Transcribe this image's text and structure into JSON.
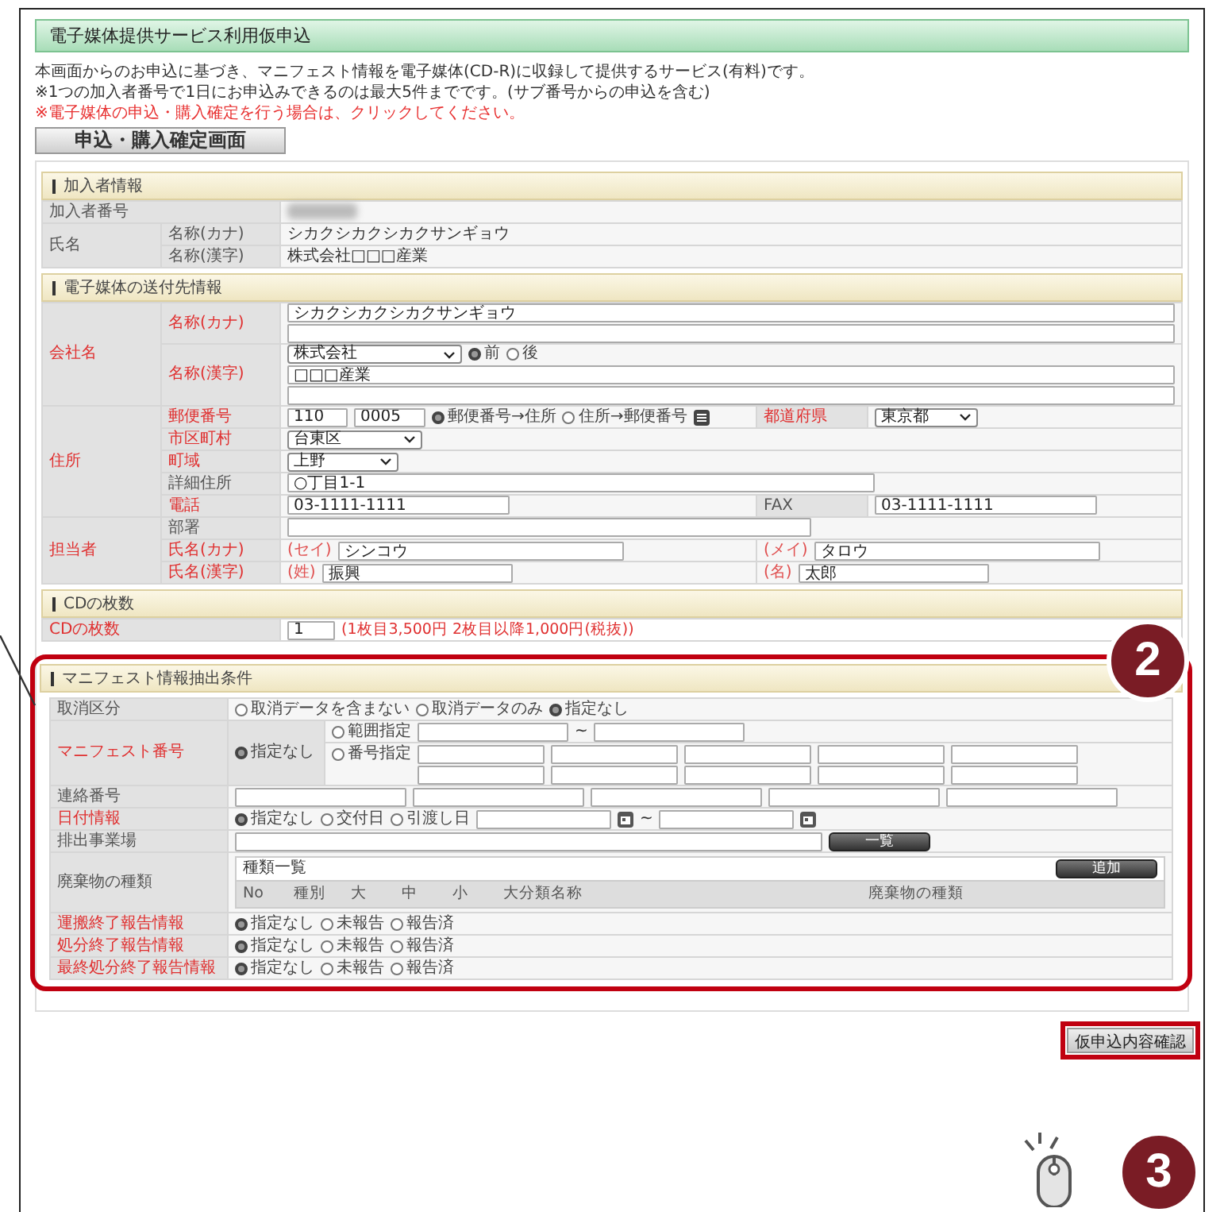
{
  "title": "電子媒体提供サービス利用仮申込",
  "intro": [
    "本画面からのお申込に基づき、マニフェスト情報を電子媒体(CD-R)に収録して提供するサービス(有料)です。",
    "※1つの加入者番号で1日にお申込みできるのは最大5件までです。(サブ番号からの申込を含む)"
  ],
  "notice": "※電子媒体の申込・購入確定を行う場合は、クリックしてください。",
  "purchase_button": "申込・購入確定画面",
  "subscriber": {
    "heading": "加入者情報",
    "number_label": "加入者番号",
    "name_label": "氏名",
    "names": [
      {
        "label": "名称(カナ)",
        "value": "シカクシカクシカクサンギョウ"
      },
      {
        "label": "名称(漢字)",
        "value": "株式会社□□□産業"
      }
    ]
  },
  "delivery": {
    "heading": "電子媒体の送付先情報",
    "company": {
      "label": {
        "text": "会社名",
        "required": true
      },
      "kana_label": {
        "text": "名称(カナ)",
        "required": true
      },
      "kana_value": "シカクシカクシカクサンギョウ",
      "kanji_label": {
        "text": "名称(漢字)",
        "required": true
      },
      "corp_type": "株式会社",
      "position_options": [
        {
          "label": "前",
          "selected": true
        },
        {
          "label": "後",
          "selected": false
        }
      ],
      "kanji_value": "□□□産業"
    },
    "address": {
      "label": {
        "text": "住所",
        "required": true
      },
      "postal_label": {
        "text": "郵便番号",
        "required": true
      },
      "postal": [
        "110",
        "0005"
      ],
      "lookup_options": [
        {
          "label": "郵便番号→住所",
          "selected": true
        },
        {
          "label": "住所→郵便番号",
          "selected": false
        }
      ],
      "prefecture_label": {
        "text": "都道府県",
        "required": true
      },
      "prefecture": "東京都",
      "city_label": {
        "text": "市区町村",
        "required": true
      },
      "city": "台東区",
      "town_label": {
        "text": "町域",
        "required": true
      },
      "town": "上野",
      "detail_label": {
        "text": "詳細住所",
        "required": false
      },
      "detail": "○丁目1-1",
      "phone_label": {
        "text": "電話",
        "required": true
      },
      "phone": "03-1111-1111",
      "fax_label": {
        "text": "FAX",
        "required": false
      },
      "fax": "03-1111-1111"
    },
    "contact": {
      "label": {
        "text": "担当者",
        "required": true
      },
      "dept_label": {
        "text": "部署",
        "required": false
      },
      "kana_label": {
        "text": "氏名(カナ)",
        "required": true
      },
      "sei_label": "(セイ)",
      "sei": "シンコウ",
      "mei_label": "(メイ)",
      "mei": "タロウ",
      "kanji_label": {
        "text": "氏名(漢字)",
        "required": true
      },
      "sei_kanji_label": "(姓)",
      "sei_kanji": "振興",
      "mei_kanji_label": "(名)",
      "mei_kanji": "太郎"
    }
  },
  "cd": {
    "heading": "CDの枚数",
    "label": {
      "text": "CDの枚数",
      "required": true
    },
    "value": "1",
    "price_note": "(1枚目3,500円 2枚目以降1,000円(税抜))"
  },
  "manifest": {
    "heading": "マニフェスト情報抽出条件",
    "cancel": {
      "label": {
        "text": "取消区分",
        "required": false
      },
      "options": [
        {
          "label": "取消データを含まない",
          "selected": false
        },
        {
          "label": "取消データのみ",
          "selected": false
        },
        {
          "label": "指定なし",
          "selected": true
        }
      ]
    },
    "number": {
      "label": {
        "text": "マニフェスト番号",
        "required": true
      },
      "none_option": {
        "label": "指定なし",
        "selected": true
      },
      "range_option": {
        "label": "範囲指定",
        "selected": false
      },
      "range_sep": "~",
      "list_option": {
        "label": "番号指定",
        "selected": false
      }
    },
    "contact_number": {
      "label": {
        "text": "連絡番号",
        "required": false
      }
    },
    "date": {
      "label": {
        "text": "日付情報",
        "required": true
      },
      "options": [
        {
          "label": "指定なし",
          "selected": true
        },
        {
          "label": "交付日",
          "selected": false
        },
        {
          "label": "引渡し日",
          "selected": false
        }
      ],
      "sep": "~"
    },
    "site": {
      "label": {
        "text": "排出事業場",
        "required": false
      },
      "button": "一覧"
    },
    "waste": {
      "label": {
        "text": "廃棄物の種類",
        "required": false
      },
      "list_title": "種類一覧",
      "add_button": "追加",
      "columns": [
        "No",
        "種別",
        "大",
        "中",
        "小",
        "大分類名称",
        "廃棄物の種類"
      ]
    },
    "reports": [
      {
        "label": {
          "text": "運搬終了報告情報",
          "required": true
        },
        "options": [
          {
            "label": "指定なし",
            "selected": true
          },
          {
            "label": "未報告",
            "selected": false
          },
          {
            "label": "報告済",
            "selected": false
          }
        ]
      },
      {
        "label": {
          "text": "処分終了報告情報",
          "required": true
        },
        "options": [
          {
            "label": "指定なし",
            "selected": true
          },
          {
            "label": "未報告",
            "selected": false
          },
          {
            "label": "報告済",
            "selected": false
          }
        ]
      },
      {
        "label": {
          "text": "最終処分終了報告情報",
          "required": true
        },
        "options": [
          {
            "label": "指定なし",
            "selected": true
          },
          {
            "label": "未報告",
            "selected": false
          },
          {
            "label": "報告済",
            "selected": false
          }
        ]
      }
    ]
  },
  "confirm_button": "仮申込内容確認",
  "markers": [
    "2",
    "3"
  ]
}
